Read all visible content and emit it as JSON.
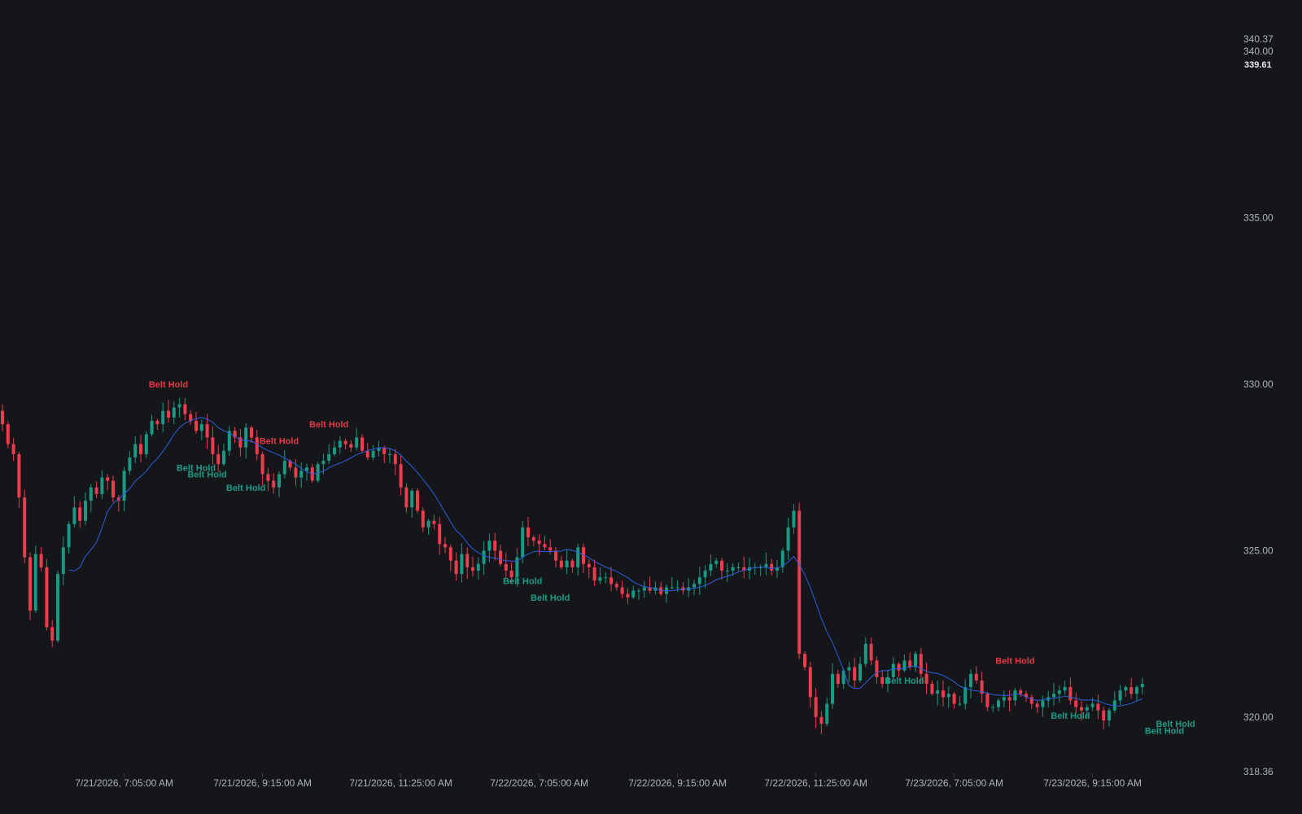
{
  "colors": {
    "background": "#151619",
    "bullish": "#1a9a84",
    "bearish": "#ef3b4e",
    "ma_line": "#2b5fe0",
    "axis_text": "#aeb3bb",
    "pattern_bull": "#1f9a86",
    "pattern_bear": "#e23a48"
  },
  "chart_data": {
    "type": "candlestick",
    "y_axis": {
      "min": 318.36,
      "max": 340.37,
      "ticks": [
        340.37,
        340.0,
        335.0,
        330.0,
        325.0,
        320.0,
        318.36
      ],
      "tick_labels": [
        "340.37",
        "340.00",
        "335.00",
        "330.00",
        "325.00",
        "320.00",
        "318.36"
      ],
      "current_price": 339.61,
      "current_price_label": "339.61"
    },
    "x_axis": {
      "tick_labels": [
        "7/21/2026, 7:05:00 AM",
        "7/21/2026, 9:15:00 AM",
        "7/21/2026, 11:25:00 AM",
        "7/22/2026, 7:05:00 AM",
        "7/22/2026, 9:15:00 AM",
        "7/22/2026, 11:25:00 AM",
        "7/23/2026, 7:05:00 AM",
        "7/23/2026, 9:15:00 AM"
      ],
      "tick_bar_index": [
        22,
        47,
        72,
        97,
        122,
        147,
        172,
        197
      ]
    },
    "closes": [
      328.8,
      328.2,
      327.9,
      326.6,
      324.8,
      323.2,
      324.9,
      324.5,
      322.7,
      322.3,
      324.3,
      325.1,
      325.8,
      326.3,
      325.9,
      326.5,
      326.9,
      326.7,
      327.2,
      327.1,
      326.6,
      326.5,
      327.4,
      327.8,
      328.2,
      327.9,
      328.5,
      328.9,
      328.8,
      329.2,
      329.0,
      329.3,
      329.4,
      329.1,
      328.9,
      328.6,
      328.8,
      328.4,
      327.9,
      327.6,
      328.0,
      328.6,
      328.4,
      328.1,
      328.7,
      328.4,
      327.9,
      327.3,
      327.1,
      326.9,
      327.3,
      327.7,
      327.5,
      327.2,
      327.4,
      327.5,
      327.1,
      327.6,
      327.7,
      327.9,
      328.1,
      328.3,
      328.2,
      328.1,
      328.4,
      328.0,
      327.8,
      328.0,
      328.1,
      327.9,
      327.9,
      327.6,
      326.9,
      326.3,
      326.8,
      326.2,
      325.7,
      325.9,
      325.8,
      325.2,
      325.1,
      324.7,
      324.3,
      324.9,
      324.5,
      324.4,
      324.6,
      325.0,
      325.3,
      325.0,
      324.6,
      324.4,
      324.2,
      324.8,
      325.7,
      325.4,
      325.3,
      325.2,
      325.1,
      325.0,
      324.7,
      324.5,
      324.7,
      324.5,
      325.1,
      324.6,
      324.5,
      324.1,
      324.2,
      324.2,
      324.0,
      323.9,
      323.7,
      323.6,
      323.8,
      323.8,
      323.9,
      323.8,
      323.9,
      323.7,
      323.9,
      323.9,
      323.9,
      323.8,
      323.9,
      324.0,
      324.2,
      324.4,
      324.6,
      324.7,
      324.4,
      324.4,
      324.5,
      324.5,
      324.4,
      324.5,
      324.5,
      324.5,
      324.6,
      324.4,
      324.5,
      325.0,
      325.7,
      326.2,
      321.9,
      321.5,
      320.6,
      320.0,
      319.8,
      320.4,
      321.3,
      321.0,
      321.4,
      321.5,
      321.1,
      321.6,
      322.2,
      321.7,
      321.2,
      321.0,
      321.2,
      321.6,
      321.4,
      321.7,
      321.5,
      321.9,
      321.3,
      321.0,
      320.7,
      320.8,
      320.6,
      320.7,
      320.4,
      320.4,
      320.9,
      321.3,
      321.1,
      320.7,
      320.3,
      320.3,
      320.5,
      320.6,
      320.5,
      320.8,
      320.7,
      320.6,
      320.4,
      320.3,
      320.5,
      320.6,
      320.7,
      320.8,
      320.9,
      320.5,
      320.3,
      320.2,
      320.3,
      320.4,
      320.2,
      319.9,
      320.2,
      320.5,
      320.8,
      320.9,
      320.7,
      320.9,
      321.0
    ],
    "patterns": [
      {
        "text": "Belt Hold",
        "type": "bearish",
        "bar": 30,
        "price": 329.9
      },
      {
        "text": "Belt Hold",
        "type": "bullish",
        "bar": 35,
        "price": 327.4
      },
      {
        "text": "Belt Hold",
        "type": "bullish",
        "bar": 37,
        "price": 327.2
      },
      {
        "text": "Belt Hold",
        "type": "bullish",
        "bar": 44,
        "price": 326.8
      },
      {
        "text": "Belt Hold",
        "type": "bearish",
        "bar": 50,
        "price": 328.2
      },
      {
        "text": "Belt Hold",
        "type": "bearish",
        "bar": 59,
        "price": 328.7
      },
      {
        "text": "Belt Hold",
        "type": "bullish",
        "bar": 94,
        "price": 324.0
      },
      {
        "text": "Belt Hold",
        "type": "bullish",
        "bar": 99,
        "price": 323.5
      },
      {
        "text": "Belt Hold",
        "type": "bullish",
        "bar": 163,
        "price": 321.0
      },
      {
        "text": "Belt Hold",
        "type": "bearish",
        "bar": 183,
        "price": 321.6
      },
      {
        "text": "Belt Hold",
        "type": "bullish",
        "bar": 193,
        "price": 319.95
      },
      {
        "text": "Belt Hold",
        "type": "bullish",
        "bar": 210,
        "price": 319.5
      },
      {
        "text": "Belt Hold",
        "type": "bullish",
        "bar": 212,
        "price": 319.7
      }
    ]
  }
}
